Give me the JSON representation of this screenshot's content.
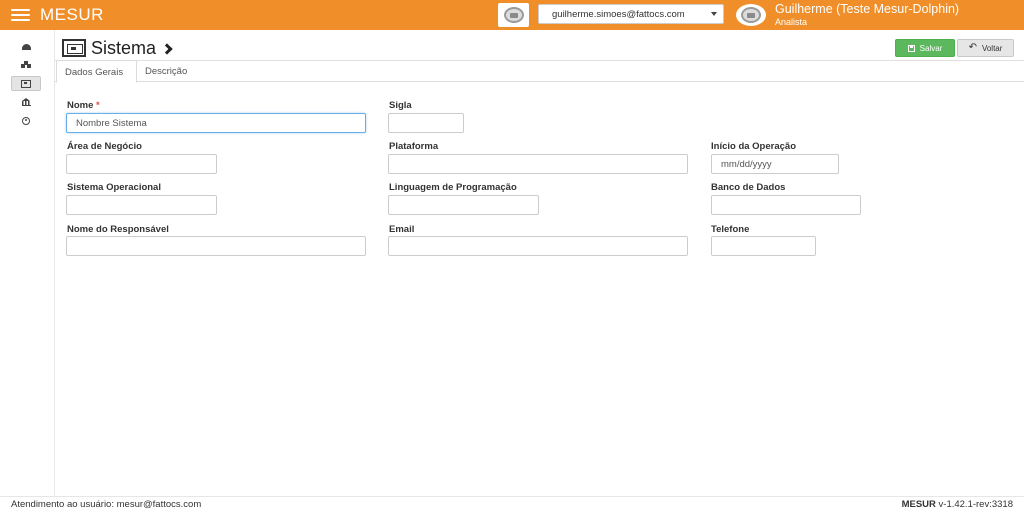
{
  "app": {
    "title": "MESUR"
  },
  "topbar": {
    "account_email": "guilherme.simoes@fattocs.com",
    "user_name": "Guilherme (Teste Mesur-Dolphin)",
    "user_role": "Analista",
    "color": "#f08f2a"
  },
  "sidebar": {
    "items": [
      {
        "icon": "dashboard-icon"
      },
      {
        "icon": "cubes-icon"
      },
      {
        "icon": "system-frame-icon",
        "active": true
      },
      {
        "icon": "institution-icon"
      },
      {
        "icon": "target-icon"
      }
    ]
  },
  "header": {
    "title": "Sistema",
    "save_label": "Salvar",
    "back_label": "Voltar"
  },
  "tabs": [
    {
      "label": "Dados Gerais",
      "active": true
    },
    {
      "label": "Descrição",
      "active": false
    }
  ],
  "form": {
    "nome": {
      "label": "Nome",
      "required_marker": "*",
      "value": "Nombre Sistema"
    },
    "sigla": {
      "label": "Sigla",
      "value": ""
    },
    "area_negocio": {
      "label": "Área de Negócio",
      "value": ""
    },
    "plataforma": {
      "label": "Plataforma",
      "value": ""
    },
    "inicio_operacao": {
      "label": "Início da Operação",
      "placeholder": "mm/dd/yyyy"
    },
    "sistema_operacional": {
      "label": "Sistema Operacional",
      "value": ""
    },
    "linguagem": {
      "label": "Linguagem de Programação",
      "value": ""
    },
    "banco_dados": {
      "label": "Banco de Dados",
      "value": ""
    },
    "responsavel": {
      "label": "Nome do Responsável",
      "value": ""
    },
    "email": {
      "label": "Email",
      "value": ""
    },
    "telefone": {
      "label": "Telefone",
      "value": ""
    }
  },
  "footer": {
    "support_text": "Atendimento ao usuário: mesur@fattocs.com",
    "version_brand": "MESUR",
    "version_text": "v-1.42.1-rev:3318"
  }
}
